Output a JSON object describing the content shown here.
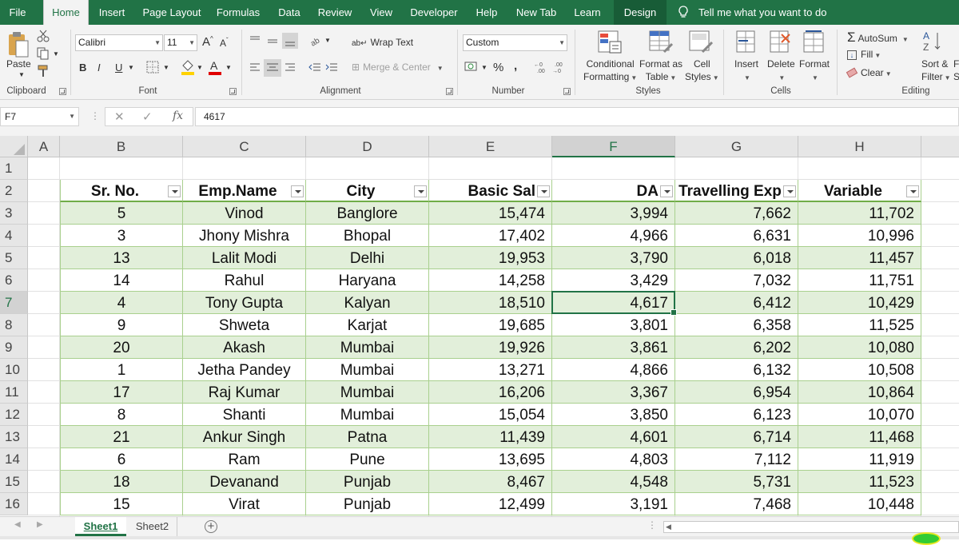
{
  "menu": {
    "tabs": [
      "File",
      "Home",
      "Insert",
      "Page Layout",
      "Formulas",
      "Data",
      "Review",
      "View",
      "Developer",
      "Help",
      "New Tab",
      "Learn",
      "Design"
    ],
    "active": "Home",
    "tell_me": "Tell me what you want to do"
  },
  "ribbon": {
    "clipboard": {
      "paste": "Paste",
      "label": "Clipboard"
    },
    "font": {
      "name": "Calibri",
      "size": "11",
      "bold": "B",
      "italic": "I",
      "underline": "U",
      "label": "Font"
    },
    "alignment": {
      "wrap_text": "Wrap Text",
      "merge_center": "Merge & Center",
      "label": "Alignment"
    },
    "number": {
      "format": "Custom",
      "percent": "%",
      "comma": ",",
      "label": "Number"
    },
    "styles": {
      "conditional_1": "Conditional",
      "conditional_2": "Formatting",
      "format_table_1": "Format as",
      "format_table_2": "Table",
      "cell_styles_1": "Cell",
      "cell_styles_2": "Styles",
      "label": "Styles"
    },
    "cells": {
      "insert": "Insert",
      "delete": "Delete",
      "format": "Format",
      "label": "Cells"
    },
    "editing": {
      "autosum": "AutoSum",
      "fill": "Fill",
      "clear": "Clear",
      "sort_1": "Sort &",
      "sort_2": "Filter",
      "find_1": "F",
      "find_2": "S",
      "label": "Editing"
    }
  },
  "formula_bar": {
    "name_box": "F7",
    "fx": "fx",
    "value": "4617"
  },
  "grid": {
    "columns": [
      "A",
      "B",
      "C",
      "D",
      "E",
      "F",
      "G",
      "H"
    ],
    "row_numbers": [
      "1",
      "2",
      "3",
      "4",
      "5",
      "6",
      "7",
      "8",
      "9",
      "10",
      "11",
      "12",
      "13",
      "14",
      "15",
      "16"
    ],
    "selected_cell": "F7",
    "headers": [
      "Sr. No.",
      "Emp.Name",
      "City",
      "Basic Sal",
      "DA",
      "Travelling Exp",
      "Variable"
    ],
    "rows": [
      [
        "5",
        "Vinod",
        "Banglore",
        "15,474",
        "3,994",
        "7,662",
        "11,702"
      ],
      [
        "3",
        "Jhony Mishra",
        "Bhopal",
        "17,402",
        "4,966",
        "6,631",
        "10,996"
      ],
      [
        "13",
        "Lalit Modi",
        "Delhi",
        "19,953",
        "3,790",
        "6,018",
        "11,457"
      ],
      [
        "14",
        "Rahul",
        "Haryana",
        "14,258",
        "3,429",
        "7,032",
        "11,751"
      ],
      [
        "4",
        "Tony Gupta",
        "Kalyan",
        "18,510",
        "4,617",
        "6,412",
        "10,429"
      ],
      [
        "9",
        "Shweta",
        "Karjat",
        "19,685",
        "3,801",
        "6,358",
        "11,525"
      ],
      [
        "20",
        "Akash",
        "Mumbai",
        "19,926",
        "3,861",
        "6,202",
        "10,080"
      ],
      [
        "1",
        "Jetha Pandey",
        "Mumbai",
        "13,271",
        "4,866",
        "6,132",
        "10,508"
      ],
      [
        "17",
        "Raj Kumar",
        "Mumbai",
        "16,206",
        "3,367",
        "6,954",
        "10,864"
      ],
      [
        "8",
        "Shanti",
        "Mumbai",
        "15,054",
        "3,850",
        "6,123",
        "10,070"
      ],
      [
        "21",
        "Ankur Singh",
        "Patna",
        "11,439",
        "4,601",
        "6,714",
        "11,468"
      ],
      [
        "6",
        "Ram",
        "Pune",
        "13,695",
        "4,803",
        "7,112",
        "11,919"
      ],
      [
        "18",
        "Devanand",
        "Punjab",
        "8,467",
        "4,548",
        "5,731",
        "11,523"
      ],
      [
        "15",
        "Virat",
        "Punjab",
        "12,499",
        "3,191",
        "7,468",
        "10,448"
      ]
    ]
  },
  "sheets": {
    "tabs": [
      "Sheet1",
      "Sheet2"
    ],
    "active": "Sheet1"
  },
  "colors": {
    "accent": "#217346",
    "band": "#e2efda",
    "table_border": "#70ad47"
  }
}
